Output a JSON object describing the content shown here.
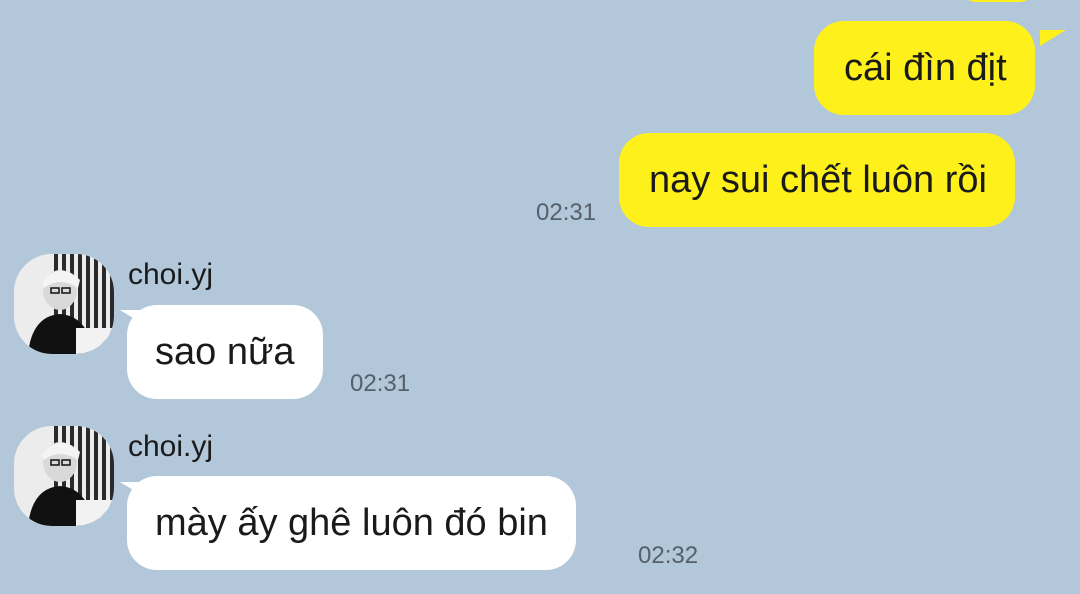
{
  "messages": [
    {
      "direction": "out",
      "text": "cái đìn địt",
      "time": ""
    },
    {
      "direction": "out",
      "text": "nay sui chết luôn rồi",
      "time": "02:31"
    },
    {
      "direction": "in",
      "sender": "choi.yj",
      "text": "sao nữa",
      "time": "02:31"
    },
    {
      "direction": "in",
      "sender": "choi.yj",
      "text": "mày ấy ghê luôn đó bin",
      "time": "02:32"
    }
  ],
  "avatar_icon": "user-avatar-photo",
  "colors": {
    "background": "#b2c7d9",
    "outgoing_bubble": "#fef01b",
    "incoming_bubble": "#ffffff",
    "time_text": "#55606a"
  }
}
